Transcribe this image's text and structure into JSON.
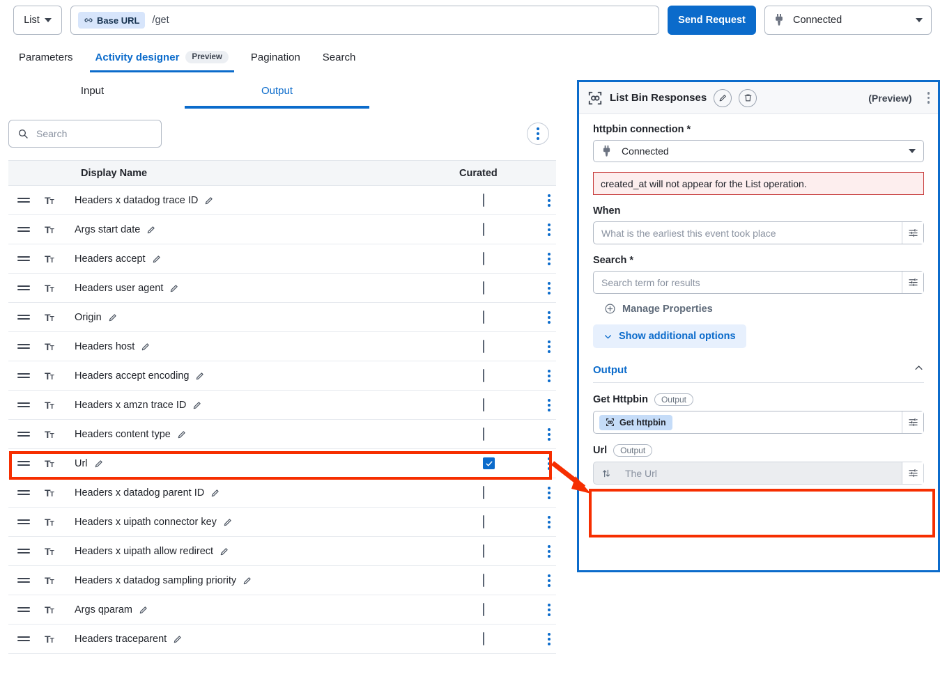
{
  "topbar": {
    "operation": "List",
    "base_url_chip": "Base URL",
    "url_path": "/get",
    "send_button": "Send Request",
    "connection_value": "Connected"
  },
  "main_tabs": [
    {
      "label": "Parameters",
      "active": false
    },
    {
      "label": "Activity designer",
      "badge": "Preview",
      "active": true
    },
    {
      "label": "Pagination",
      "active": false
    },
    {
      "label": "Search",
      "active": false
    }
  ],
  "io_tabs": [
    {
      "label": "Input",
      "active": false
    },
    {
      "label": "Output",
      "active": true
    }
  ],
  "search": {
    "placeholder": "Search",
    "value": ""
  },
  "table": {
    "columns": {
      "display_name": "Display Name",
      "curated": "Curated"
    },
    "rows": [
      {
        "display_name": "Headers x datadog trace ID",
        "curated": false
      },
      {
        "display_name": "Args start date",
        "curated": false
      },
      {
        "display_name": "Headers accept",
        "curated": false
      },
      {
        "display_name": "Headers user agent",
        "curated": false
      },
      {
        "display_name": "Origin",
        "curated": false
      },
      {
        "display_name": "Headers host",
        "curated": false
      },
      {
        "display_name": "Headers accept encoding",
        "curated": false
      },
      {
        "display_name": "Headers x amzn trace ID",
        "curated": false
      },
      {
        "display_name": "Headers content type",
        "curated": false
      },
      {
        "display_name": "Url",
        "curated": true,
        "highlighted": true
      },
      {
        "display_name": "Headers x datadog parent ID",
        "curated": false
      },
      {
        "display_name": "Headers x uipath connector key",
        "curated": false
      },
      {
        "display_name": "Headers x uipath allow redirect",
        "curated": false
      },
      {
        "display_name": "Headers x datadog sampling priority",
        "curated": false
      },
      {
        "display_name": "Args qparam",
        "curated": false
      },
      {
        "display_name": "Headers traceparent",
        "curated": false
      }
    ]
  },
  "panel": {
    "title": "List Bin Responses",
    "preview_label": "(Preview)",
    "connection_label": "httpbin connection *",
    "connection_value": "Connected",
    "warning": "created_at will not appear for the List operation.",
    "when_label": "When",
    "when_placeholder": "What is the earliest this event took place",
    "when_value": "",
    "search_label": "Search *",
    "search_placeholder": "Search term for results",
    "search_value": "",
    "manage_properties": "Manage Properties",
    "show_additional_options": "Show additional options",
    "output_section": "Output",
    "outputs": [
      {
        "name": "Get Httpbin",
        "tag": "Output",
        "chip": "Get httpbin",
        "value": "",
        "placeholder": "",
        "disabled": false,
        "highlighted": false
      },
      {
        "name": "Url",
        "tag": "Output",
        "chip": "",
        "value": "",
        "placeholder": "The Url",
        "disabled": true,
        "highlighted": true
      }
    ]
  },
  "colors": {
    "accent": "#0b6bcb",
    "highlight": "#f62e00",
    "warning_bg": "#fdeeee",
    "warning_border": "#c73a3a"
  }
}
